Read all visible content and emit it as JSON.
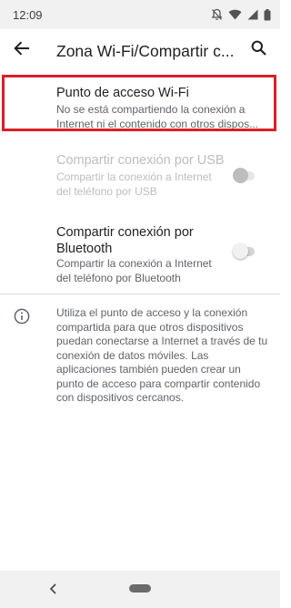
{
  "status_bar": {
    "time": "12:09",
    "icons": [
      "notifications-off-icon",
      "wifi-icon",
      "signal-icon",
      "battery-icon"
    ]
  },
  "app_bar": {
    "title": "Zona Wi-Fi/Compartir c...",
    "back_icon": "arrow-back-icon",
    "search_icon": "search-icon"
  },
  "settings": [
    {
      "title": "Punto de acceso Wi-Fi",
      "subtitle": "No se está compartiendo la conexión a Internet ni el contenido con otros dispos...",
      "enabled": true,
      "toggle": null
    },
    {
      "title": "Compartir conexión por USB",
      "subtitle": "Compartir la conexión a Internet del teléfono por USB",
      "enabled": false,
      "toggle": false
    },
    {
      "title": "Compartir conexión por Bluetooth",
      "subtitle": "Compartir la conexión a Internet del teléfono por Bluetooth",
      "enabled": true,
      "toggle": false
    }
  ],
  "info": {
    "icon": "info-icon",
    "text": "Utiliza el punto de acceso y la conexión compartida para que otros dispositivos puedan conectarse a Internet a través de tu conexión de datos móviles. Las aplicaciones también pueden crear un punto de acceso para compartir contenido con dispositivos cercanos."
  },
  "colors": {
    "highlight_border": "#d9202a",
    "status_bar": "#f1f1f1",
    "text_primary": "#202124",
    "text_secondary": "#5f6368",
    "text_disabled": "#bdbdbd"
  }
}
